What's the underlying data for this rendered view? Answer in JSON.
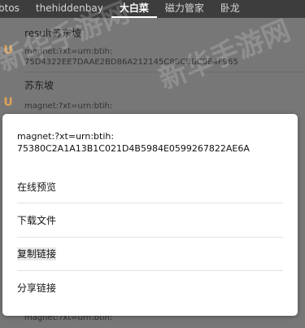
{
  "tabs": [
    {
      "label": "btos",
      "active": false
    },
    {
      "label": "thehiddenbay",
      "active": false
    },
    {
      "label": "大白菜",
      "active": true
    },
    {
      "label": "磁力管家",
      "active": false
    },
    {
      "label": "卧龙",
      "active": false
    }
  ],
  "list": [
    {
      "title": "result苏东坡",
      "sub1": "magnet:?xt=urn:btih:",
      "sub2": "75D4322EE7DAAE2BD86A212145C8BCBBC9E4F965"
    },
    {
      "title": "苏东坡",
      "sub1": "magnet:?xt=urn:btih:",
      "sub2": ""
    },
    {
      "title": "",
      "sub1": "magnet:?xt=urn:btih:",
      "sub2": ""
    }
  ],
  "watermark": "新华手游网",
  "dialog": {
    "magnet_line1": "magnet:?xt=urn:btih:",
    "magnet_line2": "75380C2A1A13B1C021D4B5984E0599267822AE6A",
    "options": [
      "在线预览",
      "下载文件",
      "复制链接",
      "分享链接"
    ]
  },
  "colors": {
    "magnet_icon": "#e0a25a",
    "tabbar": "#3d3d3d"
  }
}
